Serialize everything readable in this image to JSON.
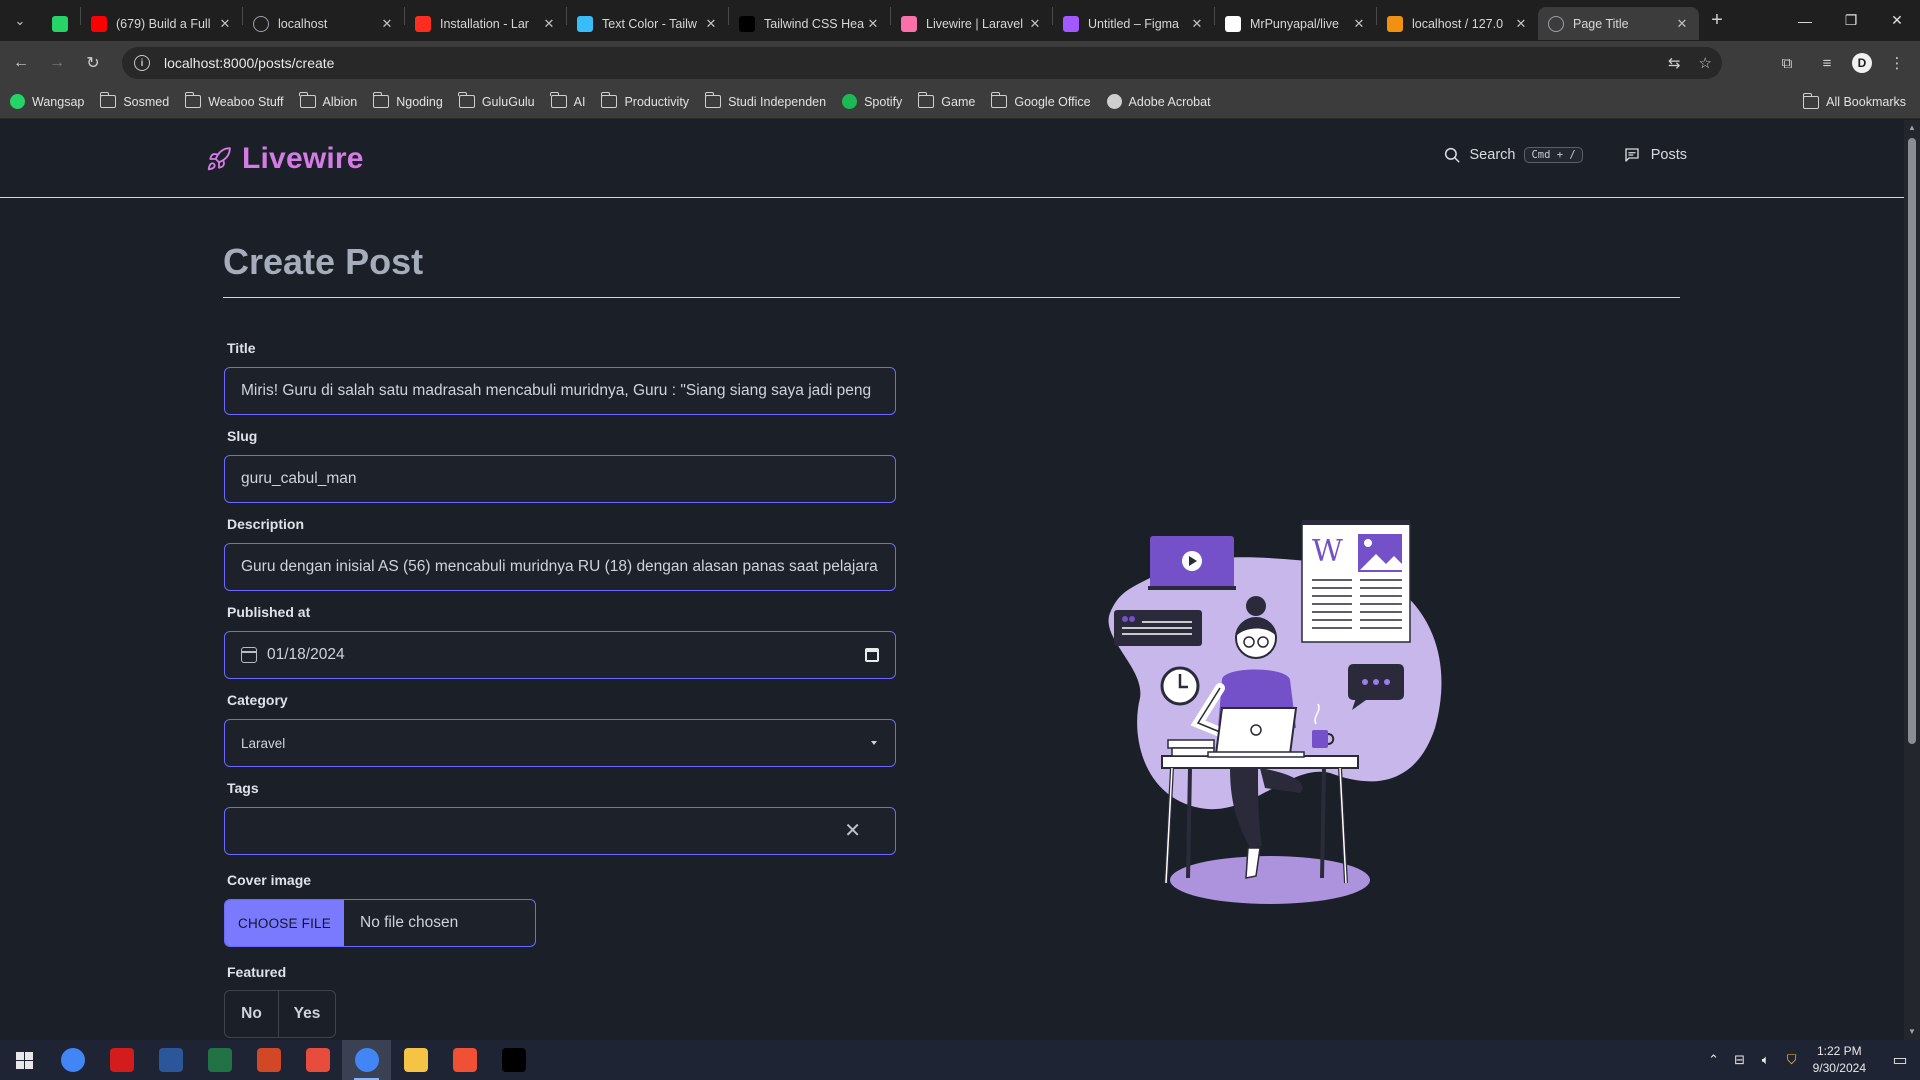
{
  "browser": {
    "tabs": [
      {
        "title": "",
        "icon": "whatsapp-icon",
        "color": "#25d366",
        "pinned": true
      },
      {
        "title": "(679) Build a Full",
        "icon": "youtube-icon",
        "color": "#ff0000"
      },
      {
        "title": "localhost",
        "icon": "globe-icon",
        "color": "#9aa0a6"
      },
      {
        "title": "Installation - Lar",
        "icon": "laravel-icon",
        "color": "#ff2d20"
      },
      {
        "title": "Text Color - Tailw",
        "icon": "tailwind-icon",
        "color": "#38bdf8"
      },
      {
        "title": "Tailwind CSS Hea",
        "icon": "tailwindui-icon",
        "color": "#000000"
      },
      {
        "title": "Livewire | Laravel",
        "icon": "livewire-icon",
        "color": "#fb70a9"
      },
      {
        "title": "Untitled – Figma",
        "icon": "figma-icon",
        "color": "#a259ff"
      },
      {
        "title": "MrPunyapal/live",
        "icon": "github-icon",
        "color": "#ffffff"
      },
      {
        "title": "localhost / 127.0",
        "icon": "phpmyadmin-icon",
        "color": "#f29111"
      },
      {
        "title": "Page Title",
        "icon": "globe-icon",
        "color": "#9aa0a6",
        "active": true
      }
    ],
    "url": "localhost:8000/posts/create",
    "bookmarks": [
      {
        "label": "Wangsap",
        "icon": "whatsapp-icon",
        "kind": "site",
        "color": "#25d366"
      },
      {
        "label": "Sosmed",
        "icon": "folder-icon",
        "kind": "folder"
      },
      {
        "label": "Weaboo Stuff",
        "icon": "folder-icon",
        "kind": "folder"
      },
      {
        "label": "Albion",
        "icon": "folder-icon",
        "kind": "folder"
      },
      {
        "label": "Ngoding",
        "icon": "folder-icon",
        "kind": "folder"
      },
      {
        "label": "GuluGulu",
        "icon": "folder-icon",
        "kind": "folder"
      },
      {
        "label": "AI",
        "icon": "folder-icon",
        "kind": "folder"
      },
      {
        "label": "Productivity",
        "icon": "folder-icon",
        "kind": "folder"
      },
      {
        "label": "Studi Independen",
        "icon": "folder-icon",
        "kind": "folder"
      },
      {
        "label": "Spotify",
        "icon": "spotify-icon",
        "kind": "site",
        "color": "#1db954"
      },
      {
        "label": "Game",
        "icon": "folder-icon",
        "kind": "folder"
      },
      {
        "label": "Google Office",
        "icon": "folder-icon",
        "kind": "folder"
      },
      {
        "label": "Adobe Acrobat",
        "icon": "globe-icon",
        "kind": "site",
        "color": "#cfcfcf"
      }
    ],
    "all_bookmarks": "All Bookmarks"
  },
  "site": {
    "brand": "Livewire",
    "brand_color": "#d47be6",
    "search_label": "Search",
    "search_shortcut": "Cmd + /",
    "posts_label": "Posts"
  },
  "form": {
    "page_title": "Create Post",
    "title_label": "Title",
    "title_value": "Miris! Guru di salah satu madrasah mencabuli muridnya, Guru : \"Siang siang saya jadi peng",
    "slug_label": "Slug",
    "slug_value": "guru_cabul_man",
    "description_label": "Description",
    "description_value": "Guru dengan inisial AS (56) mencabuli muridnya RU (18) dengan alasan panas saat pelajara",
    "published_label": "Published at",
    "published_value": "01/18/2024",
    "category_label": "Category",
    "category_value": "Laravel",
    "tags_label": "Tags",
    "tags_value": "",
    "cover_label": "Cover image",
    "cover_button": "CHOOSE FILE",
    "cover_status": "No file chosen",
    "featured_label": "Featured",
    "featured_no": "No",
    "featured_yes": "Yes",
    "accent_color": "#6b69ff"
  },
  "taskbar": {
    "apps": [
      {
        "name": "chrome-icon",
        "color": "#4285f4"
      },
      {
        "name": "acrobat-icon",
        "color": "#d41c1c"
      },
      {
        "name": "word-icon",
        "color": "#2b579a"
      },
      {
        "name": "excel-icon",
        "color": "#217346"
      },
      {
        "name": "powerpoint-icon",
        "color": "#d24726"
      },
      {
        "name": "snipping-icon",
        "color": "#e84c3d"
      },
      {
        "name": "chrome-profile-icon",
        "color": "#4285f4",
        "active": true
      },
      {
        "name": "file-explorer-icon",
        "color": "#f6c445"
      },
      {
        "name": "git-icon",
        "color": "#f05033"
      },
      {
        "name": "capcut-icon",
        "color": "#000000"
      }
    ],
    "time": "1:22 PM",
    "date": "9/30/2024"
  }
}
